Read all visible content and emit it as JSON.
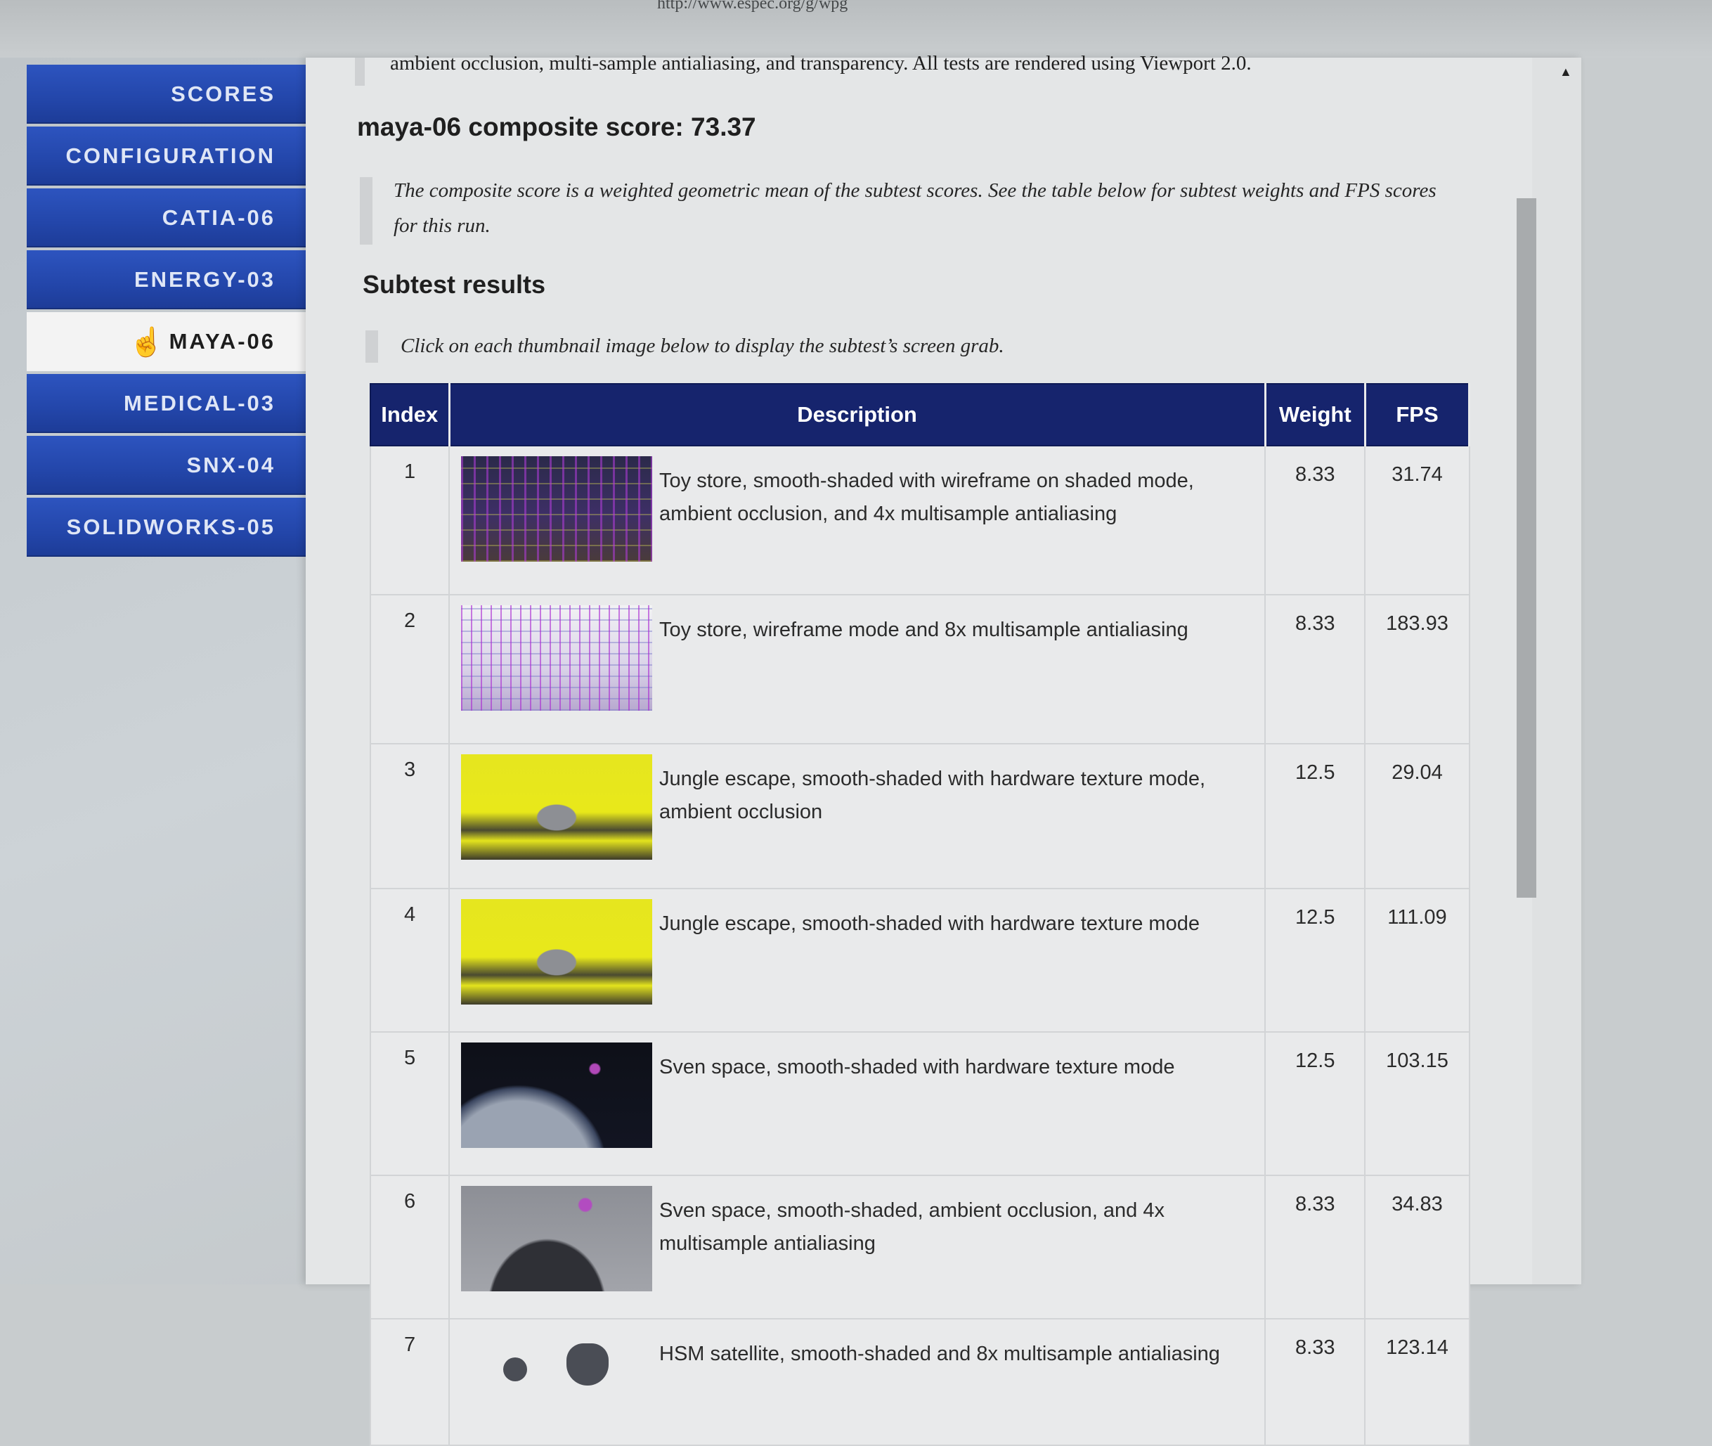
{
  "header": {
    "url_fragment": "http://www.espec.org/g/wpg"
  },
  "sidebar": {
    "items": [
      {
        "label": "SCORES",
        "active": false
      },
      {
        "label": "CONFIGURATION",
        "active": false
      },
      {
        "label": "CATIA-06",
        "active": false
      },
      {
        "label": "ENERGY-03",
        "active": false
      },
      {
        "label": "MAYA-06",
        "active": true
      },
      {
        "label": "MEDICAL-03",
        "active": false
      },
      {
        "label": "SNX-04",
        "active": false
      },
      {
        "label": "SOLIDWORKS-05",
        "active": false
      }
    ]
  },
  "main": {
    "intro_text": "ambient occlusion, multi-sample antialiasing, and transparency. All tests are rendered using Viewport 2.0.",
    "composite_title": "maya-06 composite score: 73.37",
    "composite_note": "The composite score is a weighted geometric mean of the subtest scores. See the table below for subtest weights and FPS scores for this run.",
    "subtest_title": "Subtest results",
    "subtest_hint": "Click on each thumbnail image below to display the subtest’s screen grab."
  },
  "table": {
    "headers": {
      "index": "Index",
      "description": "Description",
      "weight": "Weight",
      "fps": "FPS"
    },
    "rows": [
      {
        "index": "1",
        "thumb": "toy-store-shaded-wireframe",
        "description": "Toy store, smooth-shaded with wireframe on shaded mode, ambient occlusion, and 4x multisample antialiasing",
        "weight": "8.33",
        "fps": "31.74"
      },
      {
        "index": "2",
        "thumb": "toy-store-wireframe",
        "description": "Toy store, wireframe mode and 8x multisample antialiasing",
        "weight": "8.33",
        "fps": "183.93"
      },
      {
        "index": "3",
        "thumb": "jungle-escape-ao",
        "description": "Jungle escape, smooth-shaded with hardware texture mode, ambient occlusion",
        "weight": "12.5",
        "fps": "29.04"
      },
      {
        "index": "4",
        "thumb": "jungle-escape",
        "description": "Jungle escape, smooth-shaded with hardware texture mode",
        "weight": "12.5",
        "fps": "111.09"
      },
      {
        "index": "5",
        "thumb": "sven-space",
        "description": "Sven space, smooth-shaded with hardware texture mode",
        "weight": "12.5",
        "fps": "103.15"
      },
      {
        "index": "6",
        "thumb": "sven-space-ao",
        "description": "Sven space, smooth-shaded, ambient occlusion, and 4x multisample antialiasing",
        "weight": "8.33",
        "fps": "34.83"
      },
      {
        "index": "7",
        "thumb": "hsm-satellite",
        "description": "HSM satellite, smooth-shaded and 8x multisample antialiasing",
        "weight": "8.33",
        "fps": "123.14"
      }
    ]
  },
  "colors": {
    "nav_blue": "#2346aa",
    "table_header": "#16246d",
    "active_nav_bg": "#f3f3f3"
  },
  "icons": {
    "cursor": "hand-pointer-icon",
    "scroll_up": "triangle-up-icon"
  }
}
